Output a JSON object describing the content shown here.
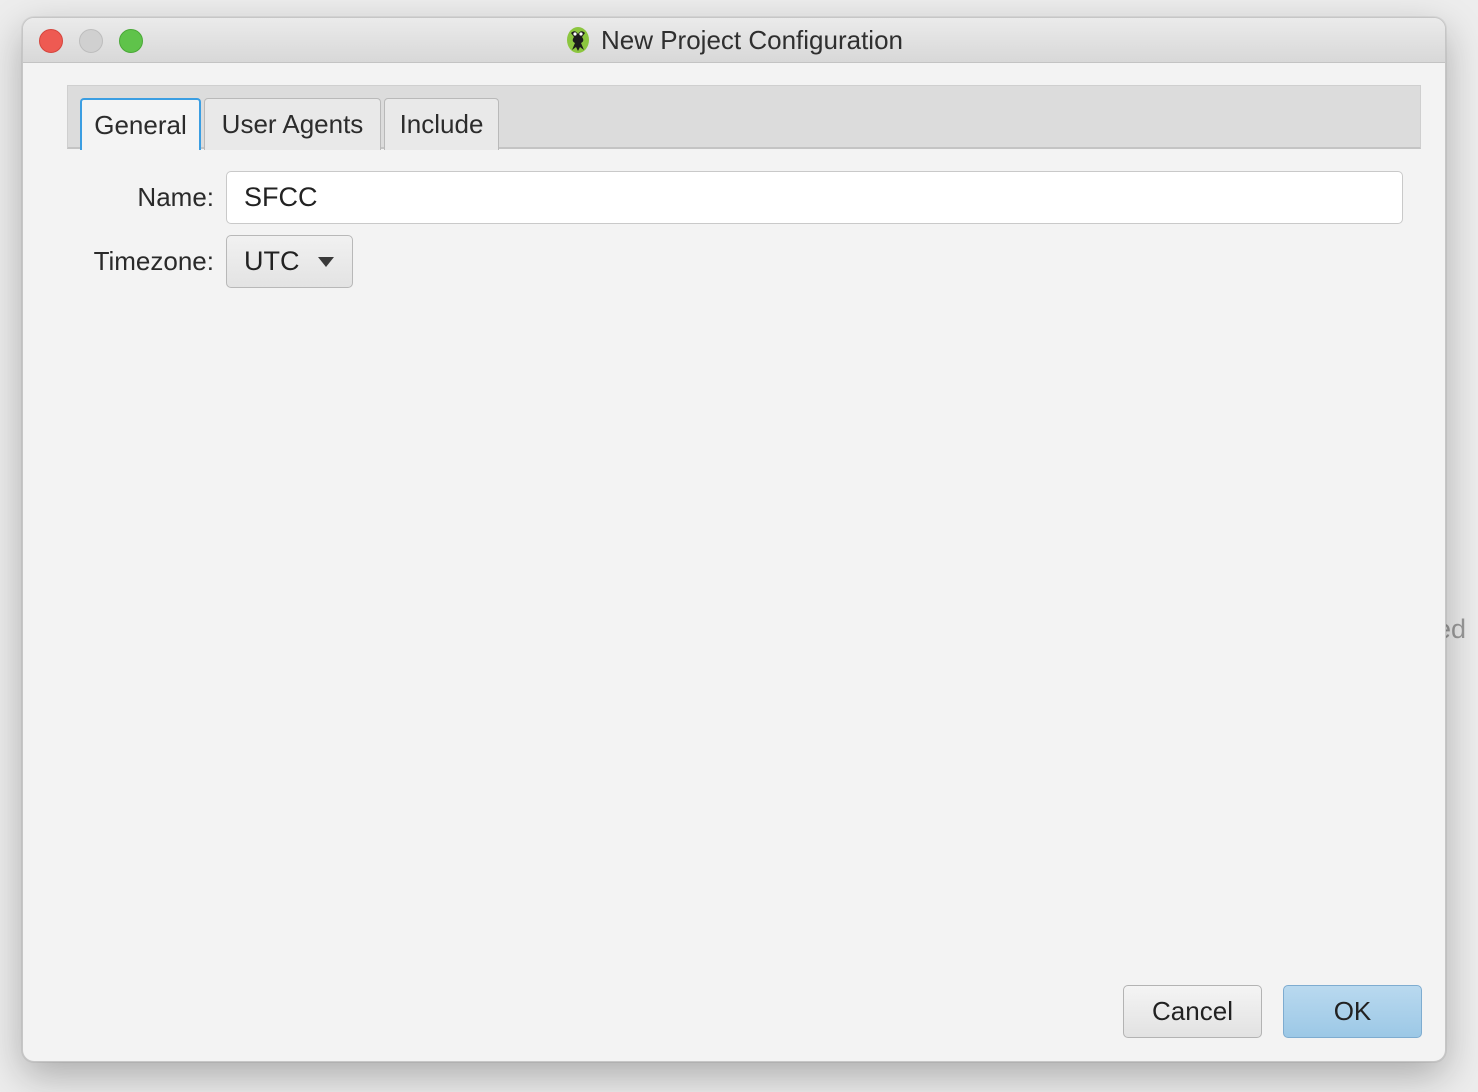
{
  "window": {
    "title": "New Project Configuration",
    "app_icon": "frog-app-icon"
  },
  "background": {
    "partial_text": "ed"
  },
  "tabs": [
    {
      "label": "General",
      "active": true
    },
    {
      "label": "User Agents",
      "active": false
    },
    {
      "label": "Include",
      "active": false
    }
  ],
  "form": {
    "name_label": "Name:",
    "name_value": "SFCC",
    "timezone_label": "Timezone:",
    "timezone_value": "UTC"
  },
  "buttons": {
    "cancel_label": "Cancel",
    "ok_label": "OK"
  },
  "colors": {
    "accent": "#3b9ee2",
    "ok_button": "#9cc8e6",
    "close_light": "#ee5a52",
    "maximize_light": "#5fc34a"
  }
}
